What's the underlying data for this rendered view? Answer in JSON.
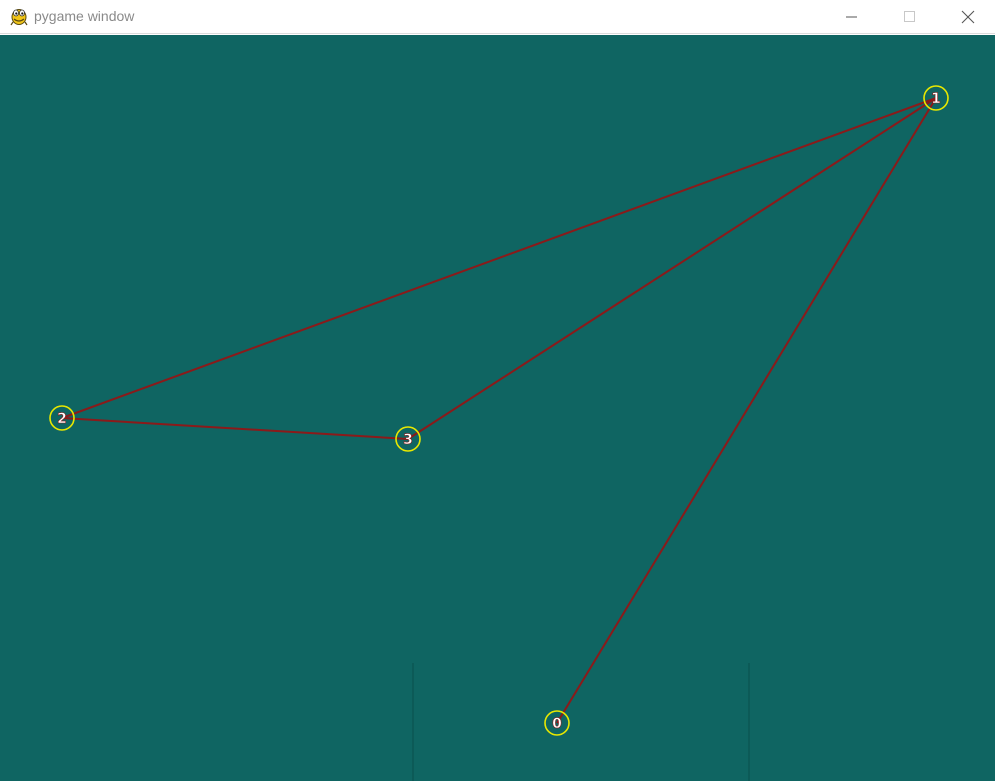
{
  "window": {
    "title": "pygame window",
    "app_icon": "pygame-snake-icon",
    "controls": {
      "minimize_icon": "minimize-icon",
      "maximize_icon": "maximize-icon",
      "close_icon": "close-icon"
    }
  },
  "canvas": {
    "background_color": "#0f6562",
    "node_ring_color": "#e8e800",
    "edge_color": "#8b1a1a",
    "label_color": "#ffffff",
    "nodes": [
      {
        "label": "0"
      },
      {
        "label": "1"
      },
      {
        "label": "2"
      },
      {
        "label": "3"
      }
    ],
    "edges": [
      {
        "from": "0",
        "to": "1"
      },
      {
        "from": "1",
        "to": "2"
      },
      {
        "from": "1",
        "to": "3"
      },
      {
        "from": "2",
        "to": "3"
      }
    ]
  }
}
